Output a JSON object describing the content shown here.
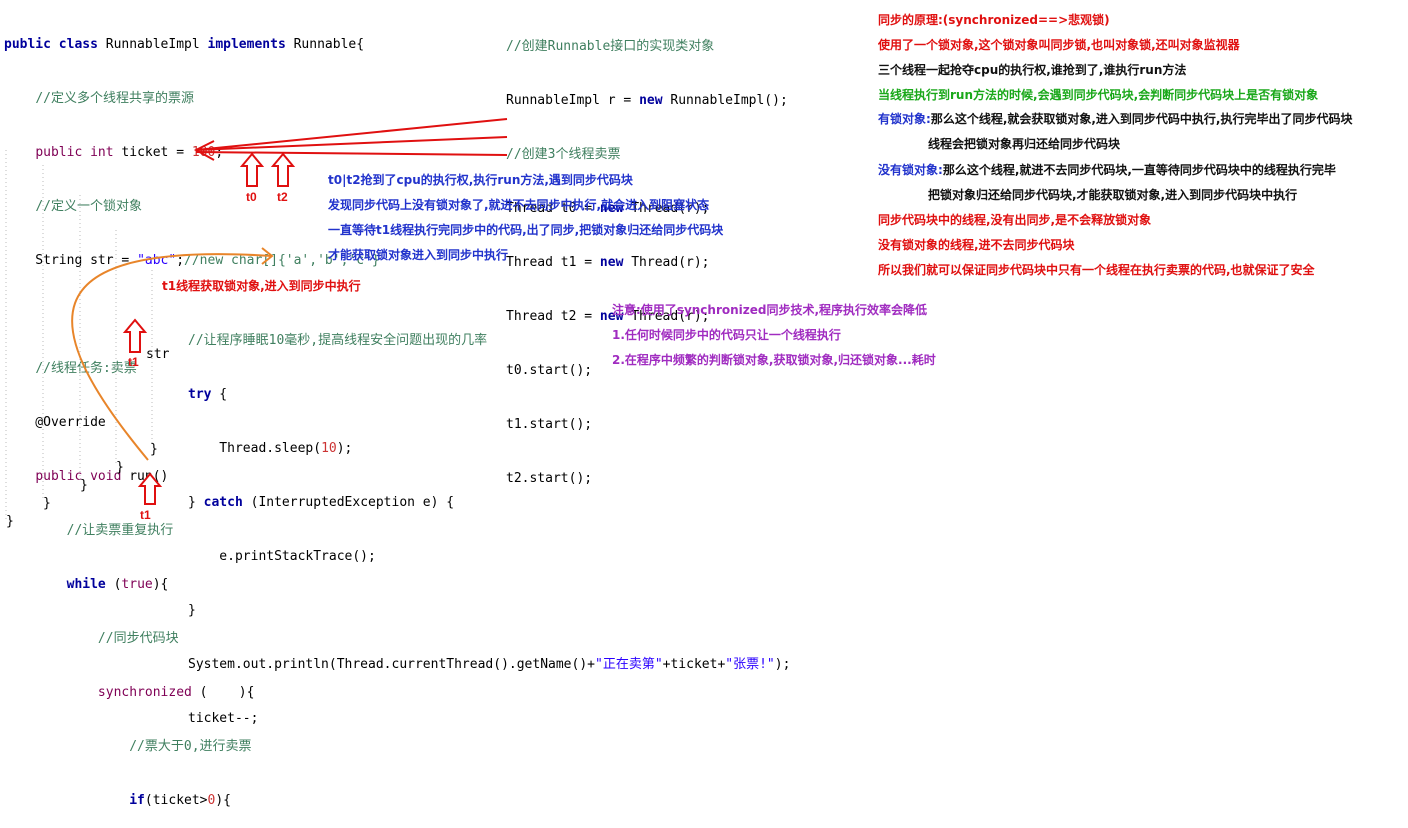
{
  "code_left": [
    {
      "name": "class-decl",
      "html": "<span class='kw'>public class</span> RunnableImpl <span class='kw'>implements</span> Runnable{"
    },
    {
      "name": "comment-ticket",
      "html": "    <span class='cm'>//定义多个线程共享的票源</span>"
    },
    {
      "name": "ticket-decl",
      "html": "    <span class='kw2'>public int</span> ticket = <span class='num'>100</span>;"
    },
    {
      "name": "comment-lock",
      "html": "    <span class='cm'>//定义一个锁对象</span>"
    },
    {
      "name": "str-decl",
      "html": "    String str = <span class='str'>\"abc\"</span>;<span class='cm'>//new char[]{'a','b','c'}</span>"
    },
    {
      "name": "blank",
      "html": " "
    },
    {
      "name": "comment-task",
      "html": "    <span class='cm'>//线程任务:卖票</span>"
    },
    {
      "name": "override",
      "html": "    @Override"
    },
    {
      "name": "run-decl",
      "html": "    <span class='kw2'>public void</span> run()"
    },
    {
      "name": "comment-repeat",
      "html": "        <span class='cm'>//让卖票重复执行</span>"
    },
    {
      "name": "while-loop",
      "html": "        <span class='kw'>while</span> (<span class='kw2'>true</span>){"
    },
    {
      "name": "comment-sync",
      "html": "            <span class='cm'>//同步代码块</span>"
    },
    {
      "name": "sync-block",
      "html": "            <span class='kw2'>synchronized</span> (    ){"
    },
    {
      "name": "comment-gt0",
      "html": "                <span class='cm'>//票大于0,进行卖票</span>"
    },
    {
      "name": "if-stmt",
      "html": "                <span class='kw'>if</span>(ticket><span class='num'>0</span>){"
    }
  ],
  "code_inner": [
    {
      "name": "comment-sleep",
      "html": "<span class='cm'>//让程序睡眠10毫秒,提高线程安全问题出现的几率</span>"
    },
    {
      "name": "try",
      "html": "<span class='kw'>try</span> {"
    },
    {
      "name": "sleep",
      "html": "    Thread.sleep(<span class='num'>10</span>);"
    },
    {
      "name": "catch",
      "html": "} <span class='kw'>catch</span> (InterruptedException e) {"
    },
    {
      "name": "print-trace",
      "html": "    e.printStackTrace();"
    },
    {
      "name": "close-catch",
      "html": "}"
    },
    {
      "name": "println",
      "html": "System.out.println(Thread.currentThread().getName()+<span class='str'>\"正在卖第\"</span>+ticket+<span class='str'>\"张票!\"</span>);"
    },
    {
      "name": "ticket-dec",
      "html": "ticket--;"
    }
  ],
  "code_right": [
    {
      "name": "comment-create",
      "html": "<span class='cm'>//创建Runnable接口的实现类对象</span>"
    },
    {
      "name": "new-impl",
      "html": "RunnableImpl r = <span class='kw'>new</span> RunnableImpl();"
    },
    {
      "name": "comment-3threads",
      "html": "<span class='cm'>//创建3个线程卖票</span>"
    },
    {
      "name": "t0-new",
      "html": "Thread t0 = <span class='kw'>new</span> Thread(r);"
    },
    {
      "name": "t1-new",
      "html": "Thread t1 = <span class='kw'>new</span> Thread(r);"
    },
    {
      "name": "t2-new",
      "html": "Thread t2 = <span class='kw'>new</span> Thread(r);"
    },
    {
      "name": "t0-start",
      "html": "t0.start();"
    },
    {
      "name": "t1-start",
      "html": "t1.start();"
    },
    {
      "name": "t2-start",
      "html": "t2.start();"
    }
  ],
  "braces": {
    "b1": "}",
    "b2": "}",
    "b3": "}",
    "b4": "}",
    "b5": "}"
  },
  "labels": {
    "str_label": "str",
    "t0": "t0",
    "t2": "t2",
    "t1_a": "t1",
    "t1_b": "t1"
  },
  "mid_notes": {
    "n1": "t0|t2抢到了cpu的执行权,执行run方法,遇到同步代码块",
    "n2": "发现同步代码上没有锁对象了,就进不去同步中执行,就会进入到阻塞状态",
    "n3": "一直等待t1线程执行完同步中的代码,出了同步,把锁对象归还给同步代码块",
    "n4": "才能获取锁对象进入到同步中执行",
    "t1_note": "t1线程获取锁对象,进入到同步中执行"
  },
  "right_notes": {
    "r1": "同步的原理:(synchronized==>悲观锁)",
    "r2": "使用了一个锁对象,这个锁对象叫同步锁,也叫对象锁,还叫对象监视器",
    "r3": "三个线程一起抢夺cpu的执行权,谁抢到了,谁执行run方法",
    "r4": "当线程执行到run方法的时候,会遇到同步代码块,会判断同步代码块上是否有锁对象",
    "r5a": "有锁对象:",
    "r5b": "那么这个线程,就会获取锁对象,进入到同步代码中执行,执行完毕出了同步代码块",
    "r6": "线程会把锁对象再归还给同步代码块",
    "r7a": "没有锁对象:",
    "r7b": "那么这个线程,就进不去同步代码块,一直等待同步代码块中的线程执行完毕",
    "r8": "把锁对象归还给同步代码块,才能获取锁对象,进入到同步代码块中执行",
    "r9": "同步代码块中的线程,没有出同步,是不会释放锁对象",
    "r10": "没有锁对象的线程,进不去同步代码块",
    "r11": "所以我们就可以保证同步代码块中只有一个线程在执行卖票的代码,也就保证了安全"
  },
  "purple_notes": {
    "p1": "注意:使用了synchronized同步技术,程序执行效率会降低",
    "p2": "1.任何时候同步中的代码只让一个线程执行",
    "p3": "2.在程序中频繁的判断锁对象,获取锁对象,归还锁对象...耗时"
  },
  "colors": {
    "red": "#e01010",
    "orange": "#e8852a"
  }
}
